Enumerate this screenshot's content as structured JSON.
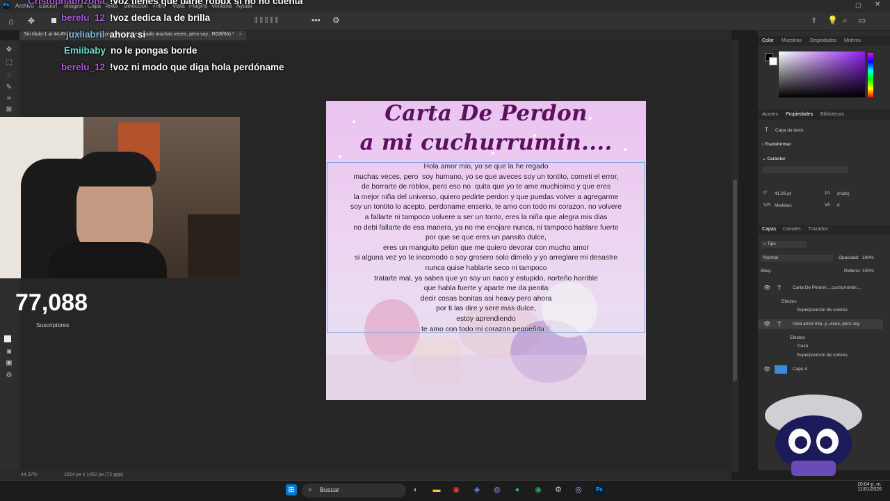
{
  "menubar": {
    "items": [
      "Archivo",
      "Edición",
      "Imagen",
      "Capa",
      "Texto",
      "Selección",
      "Filtro",
      "Vista",
      "Plugins",
      "Ventana",
      "Ayuda"
    ]
  },
  "doc_tab": {
    "label": "Sin título-1 al 44,4% (Hola amor mio, yo se que la he regado  muchas veces, pero  soy , RGB/8#) *"
  },
  "chat": [
    {
      "user": "Cristophabrizona",
      "message": "!voz tienes que darle robux si no no cuenta",
      "color": "#a95ad8"
    },
    {
      "user": "berelu_12",
      "message": "!voz dedica la de brilla",
      "color": "#a95ad8"
    },
    {
      "user": "juxliabril",
      "message": "ahora si",
      "color": "#7fb2d9"
    },
    {
      "user": "Emiibaby",
      "message": "no le pongas borde",
      "color": "#6fe0c9"
    },
    {
      "user": "berelu_12",
      "message": "!voz ni modo que diga hola perdóname",
      "color": "#a95ad8"
    }
  ],
  "subscribers": {
    "count": "77,088",
    "label": "Suscriptores"
  },
  "artwork": {
    "title_line1": "Carta De Perdon",
    "title_line2": "a mi cuchurrumin....",
    "letter": "Hola amor mio, yo se que la he regado\nmuchas veces, pero  soy humano, yo se que aveces soy un tontito, cometi el error,\nde borrarte de roblox, pero eso no  quita que yo te ame muchisimo y que eres\nla mejor niña del universo, quiero pedirte perdon y que puedas volver a agregarme\nsoy un tontito lo acepto, perdoname enserio, te amo con todo mi corazon, no volvere\na fallarte ni tampoco volvere a ser un tonto, eres la niña que alegra mis dias\nno debi fallarte de esa manera, ya no me enojare nunca, ni tampoco hablare fuerte\npor que se que eres un pansito dulce,\neres un manguito pelon que me quiero devorar con mucho amor\nsi alguna vez yo te incomodo o soy grosero solo dimelo y yo arreglare mi desastre\nnunca quise hablarte seco ni tampoco\ntratarte mal, ya sabes que yo soy un naco y estupido, norteño horrible\nque habla fuerte y aparte me da penita\ndecir cosas bonitas asi heavy pero ahora\npor ti las dire y sere mas dulce,\nestoy aprendiendo\nte amo con todo mi corazon pequeñita♡"
  },
  "status": {
    "zoom": "44.37%",
    "doc_info": "1554 px x 1452 px (72 ppp)"
  },
  "right_panel": {
    "color_tabs": [
      "Color",
      "Muestras",
      "Degradados",
      "Motivos"
    ],
    "props_tabs": [
      "Ajustes",
      "Propiedades",
      "Bibliotecas"
    ],
    "props_layer_type": "Capa de texto",
    "transform_label": "Transformar",
    "character_label": "Carácter",
    "font_size": "41,06 pt",
    "leading": "(Auto)",
    "tracking_label": "Medidas",
    "kerning": "0",
    "layers_tabs": [
      "Capas",
      "Canales",
      "Trazados"
    ],
    "filter_kind": "Tipo",
    "blend_mode": "Normal",
    "opacity_label": "Opacidad:",
    "opacity_value": "100%",
    "lock_label": "Bloq.:",
    "fill_label": "Relleno:",
    "fill_value": "100%",
    "layers": [
      {
        "name": "Carta De Perdon ...cuchurrumin....",
        "kind": "T"
      },
      {
        "name": "Efectos",
        "kind": "sub"
      },
      {
        "name": "Superposición de colores",
        "kind": "subsub"
      },
      {
        "name": "Hola amor mio, y...eces, pero  soy",
        "kind": "T"
      },
      {
        "name": "Efectos",
        "kind": "sub"
      },
      {
        "name": "Trazo",
        "kind": "subsub"
      },
      {
        "name": "Superposición de colores",
        "kind": "subsub"
      },
      {
        "name": "Capa 4",
        "kind": "img"
      }
    ]
  },
  "taskbar": {
    "search_label": "Buscar",
    "time": "10:04 p. m.",
    "date": "11/01/2026"
  },
  "colors": {
    "accent_purple": "#5c1060",
    "selection_blue": "#7ea7e6",
    "ps_blue": "#31a8ff"
  }
}
